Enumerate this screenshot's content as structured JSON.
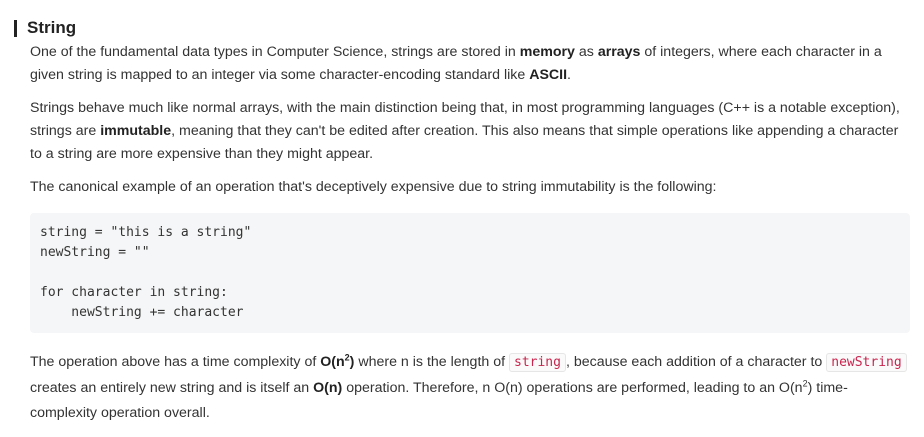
{
  "section": {
    "title": "String"
  },
  "p1": {
    "t1": "One of the fundamental data types in Computer Science, strings are stored in ",
    "b1": "memory",
    "t2": " as ",
    "b2": "arrays",
    "t3": " of integers, where each character in a given string is mapped to an integer via some character-encoding standard like ",
    "b3": "ASCII",
    "t4": "."
  },
  "p2": {
    "t1": "Strings behave much like normal arrays, with the main distinction being that, in most programming languages (C++ is a notable exception), strings are ",
    "b1": "immutable",
    "t2": ", meaning that they can't be edited after creation. This also means that simple operations like appending a character to a string are more expensive than they might appear."
  },
  "p3": {
    "text": "The canonical example of an operation that's deceptively expensive due to string immutability is the following:"
  },
  "code": {
    "lines": [
      "string = \"this is a string\"",
      "newString = \"\"",
      "for character in string:",
      "    newString += character"
    ]
  },
  "p4": {
    "t1": "The operation above has a time complexity of ",
    "b1": "O(n",
    "b1sup": "2",
    "b1end": ")",
    "t2": " where n is the length of ",
    "code1": "string",
    "t3": ", because each addition of a character to ",
    "code2": "newString",
    "t4": " creates an entirely new string and is itself an ",
    "b2": "O(n)",
    "t5": " operation. Therefore, n O(n) operations are performed, leading to an O(n",
    "t5sup": "2",
    "t6": ") time-complexity operation overall."
  }
}
